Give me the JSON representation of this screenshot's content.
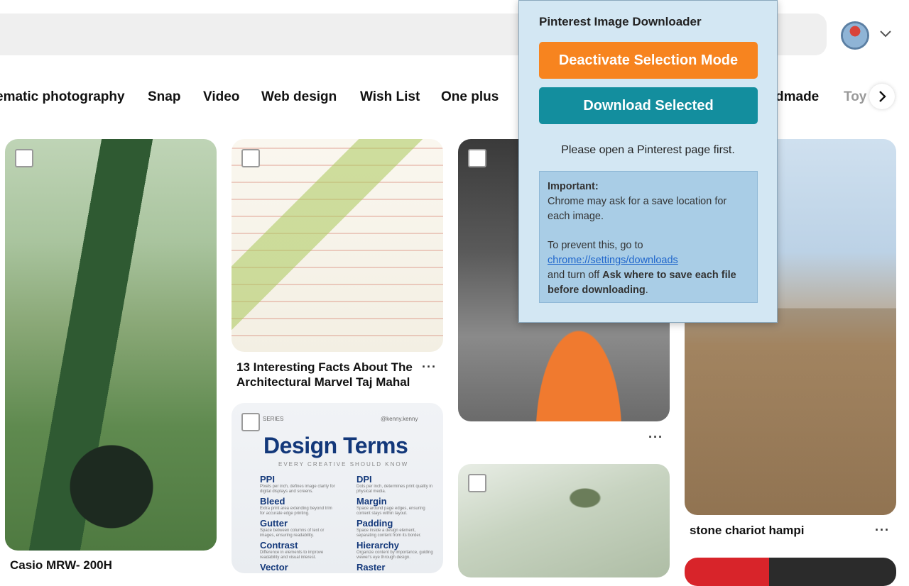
{
  "categories": [
    "ematic photography",
    "Snap",
    "Video",
    "Web design",
    "Wish List",
    "One plus",
    "dmade",
    "Toy"
  ],
  "pins": {
    "taj_title": "13 Interesting Facts About The Architectural Marvel Taj Mahal",
    "watch_title": "Casio MRW- 200H",
    "hampi_title": "stone chariot hampi",
    "more": "···"
  },
  "design_terms": {
    "series": "SERIES",
    "handle": "@kenny.kenny",
    "title": "Design Terms",
    "subtitle": "EVERY CREATIVE SHOULD KNOW",
    "terms_left": [
      "PPI",
      "Bleed",
      "Gutter",
      "Contrast",
      "Vector"
    ],
    "terms_right": [
      "DPI",
      "Margin",
      "Padding",
      "Hierarchy",
      "Raster"
    ],
    "desc_left": [
      "Pixels per inch, defines image clarity for digital displays and screens.",
      "Extra print area extending beyond trim for accurate edge printing.",
      "Space between columns of text or images, ensuring readability.",
      "Difference in elements to improve readability and visual interest."
    ],
    "desc_right": [
      "Dots per inch, determines print quality in physical media.",
      "Space around page edges, ensuring content stays within layout.",
      "Space inside a design element, separating content from its border.",
      "Organize content by importance, guiding viewer's eye through design."
    ]
  },
  "popup": {
    "title": "Pinterest Image Downloader",
    "deactivate_label": "Deactivate Selection Mode",
    "download_label": "Download Selected",
    "status": "Please open a Pinterest page first.",
    "note": {
      "heading": "Important:",
      "line1": "Chrome may ask for a save location for each image.",
      "line2": "To prevent this, go to",
      "link": "chrome://settings/downloads",
      "line3_pre": "and turn off ",
      "line3_bold": "Ask where to save each file before downloading",
      "line3_post": "."
    }
  },
  "colors": {
    "orange": "#f7841f",
    "teal": "#138e9e",
    "popup_bg": "#d3e7f3",
    "note_bg": "#a9cde6"
  }
}
